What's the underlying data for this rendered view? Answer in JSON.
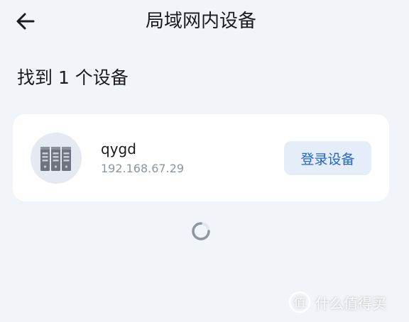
{
  "header": {
    "back_icon": "arrow-left-icon",
    "title": "局域网内设备"
  },
  "summary": {
    "found_text": "找到 1 个设备"
  },
  "devices": [
    {
      "icon": "server-icon",
      "name": "qygd",
      "ip": "192.168.67.29",
      "action_label": "登录设备"
    }
  ],
  "loading": {
    "icon": "loading-spinner-icon"
  },
  "watermark": {
    "text": "什么值得买"
  },
  "colors": {
    "background": "#f1f4f9",
    "card": "#ffffff",
    "accent": "#2166c8",
    "button_bg": "#e5edf9",
    "secondary_text": "#8c95a3"
  }
}
